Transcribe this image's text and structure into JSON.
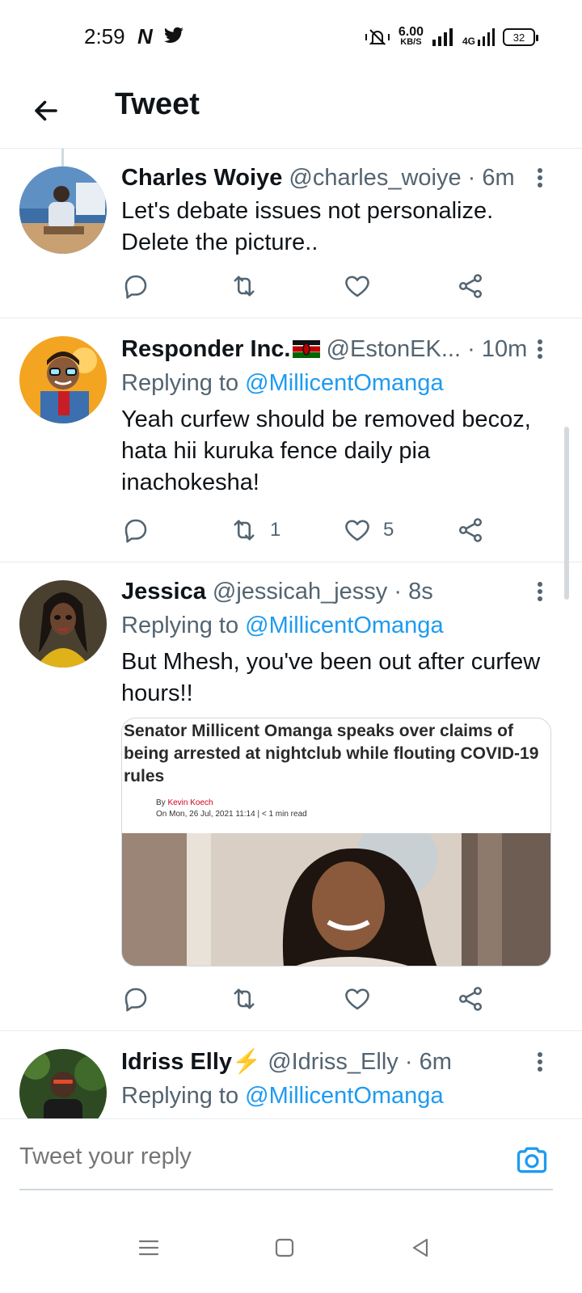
{
  "status_bar": {
    "time": "2:59",
    "app_n": "N",
    "speed_value": "6.00",
    "speed_unit": "KB/S",
    "network": "4G",
    "battery": "32"
  },
  "header": {
    "title": "Tweet",
    "back_icon": "arrow-left-icon"
  },
  "tweets": [
    {
      "name": "Charles Woiye",
      "handle": "@charles_woiye",
      "sep": "·",
      "time": "6m",
      "replying_to": "",
      "mention": "",
      "text_lines": [
        "Let's debate issues not personalize.",
        "Delete the picture.."
      ],
      "retweets": "",
      "likes": ""
    },
    {
      "name": "Responder Inc.",
      "flag": "kenya-flag-icon",
      "handle": "@EstonEK...",
      "sep": "·",
      "time": "10m",
      "replying_to": "Replying to",
      "mention": "@MillicentOmanga",
      "text_lines": [
        "Yeah curfew should be removed becoz,",
        "hata hii kuruka fence daily pia",
        "inachokesha!"
      ],
      "retweets": "1",
      "likes": "5"
    },
    {
      "name": "Jessica",
      "handle": "@jessicah_jessy",
      "sep": "·",
      "time": "8s",
      "replying_to": "Replying to",
      "mention": "@MillicentOmanga",
      "text_lines": [
        "But Mhesh, you've been out after curfew",
        "hours!!"
      ],
      "card": {
        "headline": "Senator Millicent Omanga speaks over claims of being arrested at nightclub while flouting COVID-19 rules",
        "by": "By",
        "author": "Kevin Koech",
        "date_line": "On Mon, 26 Jul, 2021 11:14 | < 1 min read"
      },
      "retweets": "",
      "likes": ""
    },
    {
      "name": "Idriss Elly",
      "emoji": "⚡",
      "handle": "@Idriss_Elly",
      "sep": "·",
      "time": "6m",
      "replying_to": "Replying to",
      "mention": "@MillicentOmanga"
    }
  ],
  "composer": {
    "placeholder": "Tweet your reply",
    "camera_icon": "camera-icon"
  },
  "navbar": {
    "icons": [
      "menu-icon",
      "home-square-icon",
      "back-triangle-icon"
    ]
  },
  "colors": {
    "accent": "#1d9bf0",
    "secondary_text": "#536471",
    "primary_text": "#0f1419",
    "divider": "#e6ecf0"
  }
}
